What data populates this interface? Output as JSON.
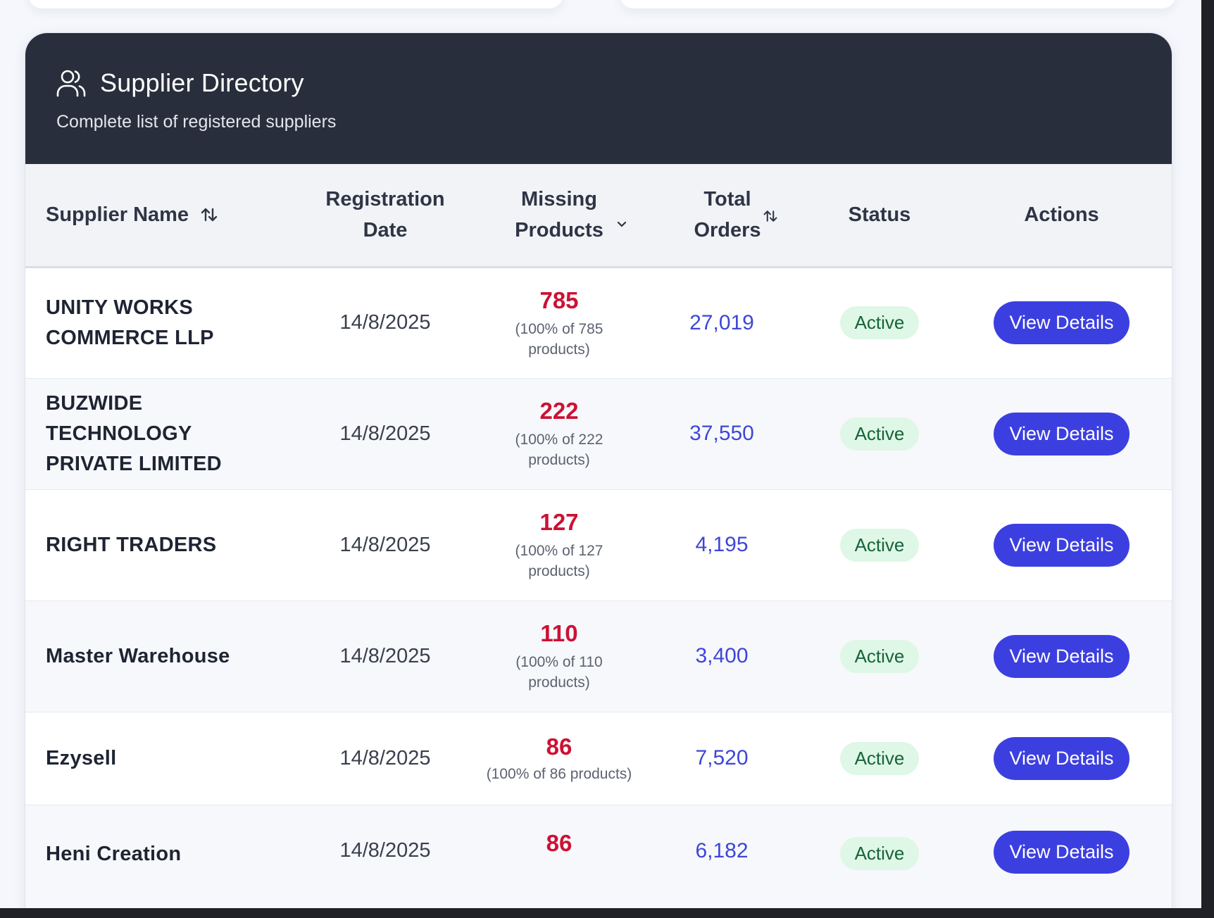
{
  "header": {
    "title": "Supplier Directory",
    "subtitle": "Complete list of registered suppliers",
    "icon": "users-icon"
  },
  "table": {
    "columns": {
      "name": "Supplier Name",
      "date_line1": "Registration",
      "date_line2": "Date",
      "missing_line1": "Missing",
      "missing_line2": "Products",
      "orders_line1": "Total",
      "orders_line2": "Orders",
      "status": "Status",
      "actions": "Actions"
    },
    "rows": [
      {
        "name": "UNITY WORKS COMMERCE LLP",
        "date": "14/8/2025",
        "missing": "785",
        "missing_line1": "(100% of 785",
        "missing_line2": "products)",
        "orders": "27,019",
        "status": "Active",
        "action": "View Details"
      },
      {
        "name": "BUZWIDE TECHNOLOGY PRIVATE LIMITED",
        "date": "14/8/2025",
        "missing": "222",
        "missing_line1": "(100% of 222",
        "missing_line2": "products)",
        "orders": "37,550",
        "status": "Active",
        "action": "View Details"
      },
      {
        "name": "RIGHT TRADERS",
        "date": "14/8/2025",
        "missing": "127",
        "missing_line1": "(100% of 127",
        "missing_line2": "products)",
        "orders": "4,195",
        "status": "Active",
        "action": "View Details"
      },
      {
        "name": "Master Warehouse",
        "date": "14/8/2025",
        "missing": "110",
        "missing_line1": "(100% of 110",
        "missing_line2": "products)",
        "orders": "3,400",
        "status": "Active",
        "action": "View Details"
      },
      {
        "name": "Ezysell",
        "date": "14/8/2025",
        "missing": "86",
        "missing_line1": "(100% of 86 products)",
        "missing_line2": "",
        "orders": "7,520",
        "status": "Active",
        "action": "View Details"
      },
      {
        "name": "Heni Creation",
        "date": "14/8/2025",
        "missing": "86",
        "missing_line1": "",
        "missing_line2": "",
        "orders": "6,182",
        "status": "Active",
        "action": "View Details"
      }
    ]
  },
  "colors": {
    "header_bg": "#282e3b",
    "missing": "#cc1234",
    "orders": "#3e46d8",
    "button": "#3c3fe0",
    "badge_bg": "#dff7e6",
    "badge_text": "#17633a"
  }
}
